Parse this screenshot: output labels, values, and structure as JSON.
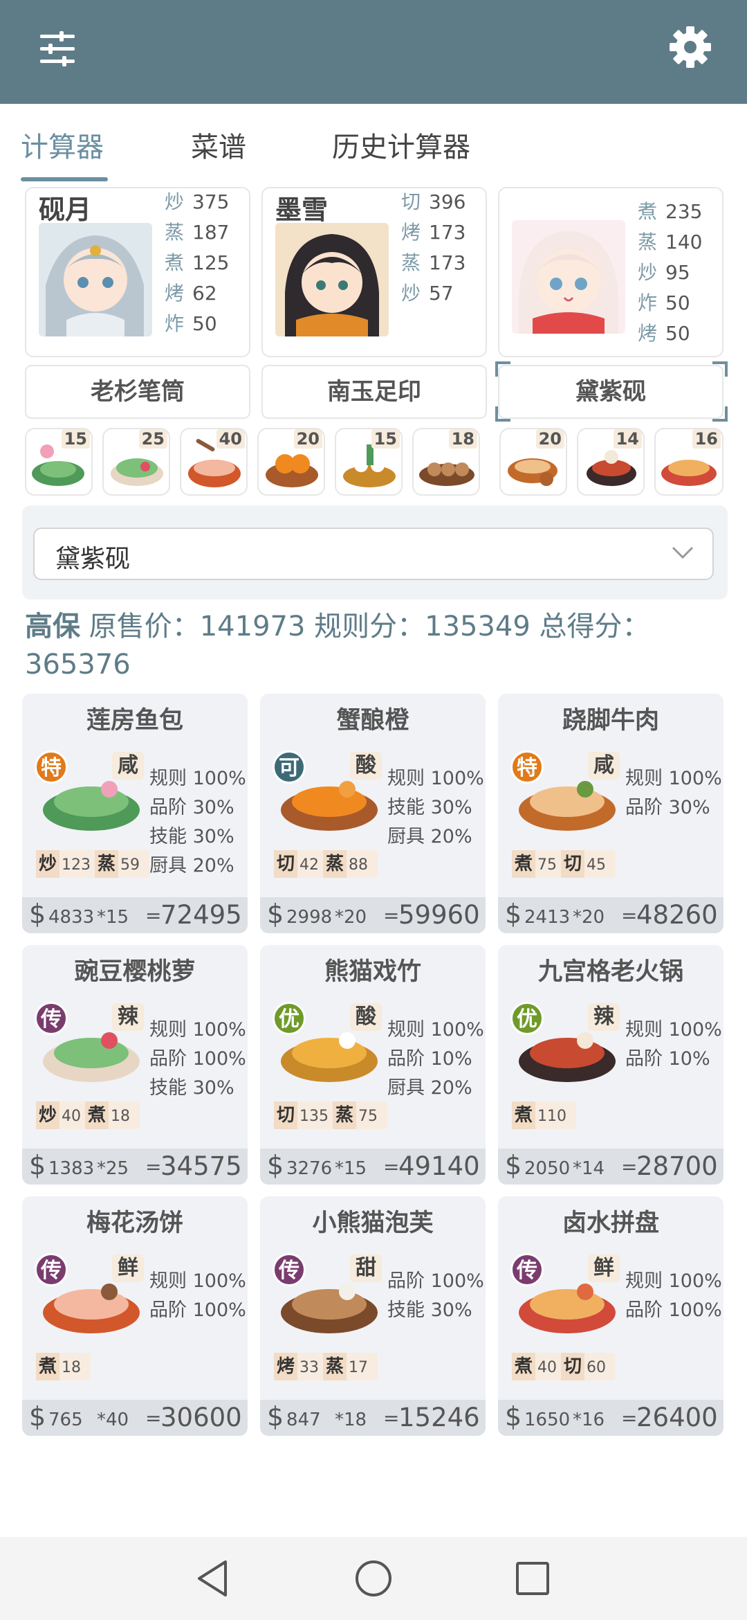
{
  "tabs": [
    {
      "label": "计算器",
      "active": true
    },
    {
      "label": "菜谱",
      "active": false
    },
    {
      "label": "历史计算器",
      "active": false
    }
  ],
  "chefs": [
    {
      "name": "砚月",
      "stats": [
        [
          "炒",
          "375"
        ],
        [
          "蒸",
          "187"
        ],
        [
          "煮",
          "125"
        ],
        [
          "烤",
          "62"
        ],
        [
          "炸",
          "50"
        ]
      ]
    },
    {
      "name": "墨雪",
      "stats": [
        [
          "切",
          "396"
        ],
        [
          "烤",
          "173"
        ],
        [
          "蒸",
          "173"
        ],
        [
          "炒",
          "57"
        ]
      ]
    },
    {
      "name": "",
      "stats": [
        [
          "煮",
          "235"
        ],
        [
          "蒸",
          "140"
        ],
        [
          "炒",
          "95"
        ],
        [
          "炸",
          "50"
        ],
        [
          "烤",
          "50"
        ]
      ]
    }
  ],
  "equipment": [
    "老杉笔筒",
    "南玉足印",
    "黛紫砚"
  ],
  "mini_dishes": [
    "15",
    "25",
    "40",
    "20",
    "15",
    "18",
    "20",
    "14",
    "16"
  ],
  "selected_equipment": "黛紫砚",
  "summary": {
    "tag": "高保",
    "text": "原售价：141973 规则分：135349 总得分：",
    "total": "365376"
  },
  "dishes": [
    {
      "name": "莲房鱼包",
      "badge": "特",
      "badge_color": "#e07a1a",
      "flavor": "咸",
      "rules": [
        "规则 100%",
        "品阶 30%",
        "技能 30%",
        "厨具 20%"
      ],
      "skills": [
        [
          "炒",
          "123"
        ],
        [
          "蒸",
          "59"
        ]
      ],
      "price": "4833",
      "mult": "*15",
      "total": "72495"
    },
    {
      "name": "蟹酿橙",
      "badge": "可",
      "badge_color": "#3e6a78",
      "flavor": "酸",
      "rules": [
        "规则 100%",
        "技能 30%",
        "厨具 20%"
      ],
      "skills": [
        [
          "切",
          "42"
        ],
        [
          "蒸",
          "88"
        ]
      ],
      "price": "2998",
      "mult": "*20",
      "total": "59960"
    },
    {
      "name": "跷脚牛肉",
      "badge": "特",
      "badge_color": "#e07a1a",
      "flavor": "咸",
      "rules": [
        "规则 100%",
        "品阶 30%"
      ],
      "skills": [
        [
          "煮",
          "75"
        ],
        [
          "切",
          "45"
        ]
      ],
      "price": "2413",
      "mult": "*20",
      "total": "48260"
    },
    {
      "name": "豌豆樱桃萝",
      "badge": "传",
      "badge_color": "#7a3c6e",
      "flavor": "辣",
      "rules": [
        "规则 100%",
        "品阶 100%",
        "技能 30%"
      ],
      "skills": [
        [
          "炒",
          "40"
        ],
        [
          "煮",
          "18"
        ]
      ],
      "price": "1383",
      "mult": "*25",
      "total": "34575"
    },
    {
      "name": "熊猫戏竹",
      "badge": "优",
      "badge_color": "#6f9a2a",
      "flavor": "酸",
      "rules": [
        "规则 100%",
        "品阶 10%",
        "厨具 20%"
      ],
      "skills": [
        [
          "切",
          "135"
        ],
        [
          "蒸",
          "75"
        ]
      ],
      "price": "3276",
      "mult": "*15",
      "total": "49140"
    },
    {
      "name": "九宫格老火锅",
      "badge": "优",
      "badge_color": "#6f9a2a",
      "flavor": "辣",
      "rules": [
        "规则 100%",
        "品阶 10%"
      ],
      "skills": [
        [
          "煮",
          "110"
        ]
      ],
      "price": "2050",
      "mult": "*14",
      "total": "28700"
    },
    {
      "name": "梅花汤饼",
      "badge": "传",
      "badge_color": "#7a3c6e",
      "flavor": "鲜",
      "rules": [
        "规则 100%",
        "品阶 100%"
      ],
      "skills": [
        [
          "煮",
          "18"
        ]
      ],
      "price": "765",
      "mult": "*40",
      "total": "30600"
    },
    {
      "name": "小熊猫泡芙",
      "badge": "传",
      "badge_color": "#7a3c6e",
      "flavor": "甜",
      "rules": [
        "品阶 100%",
        "技能 30%"
      ],
      "skills": [
        [
          "烤",
          "33"
        ],
        [
          "蒸",
          "17"
        ]
      ],
      "price": "847",
      "mult": "*18",
      "total": "15246"
    },
    {
      "name": "卤水拼盘",
      "badge": "传",
      "badge_color": "#7a3c6e",
      "flavor": "鲜",
      "rules": [
        "规则 100%",
        "品阶 100%"
      ],
      "skills": [
        [
          "煮",
          "40"
        ],
        [
          "切",
          "60"
        ]
      ],
      "price": "1650",
      "mult": "*16",
      "total": "26400"
    }
  ],
  "currency_symbol": "$",
  "equals": "=",
  "icons": [
    "sliders-icon",
    "gear-icon",
    "chevron-down-icon",
    "back-nav-icon",
    "home-nav-icon",
    "recents-nav-icon"
  ],
  "colors": {
    "accent": "#5e7c88",
    "panel": "#f0f2f6",
    "price_bar": "#dde0e5"
  }
}
